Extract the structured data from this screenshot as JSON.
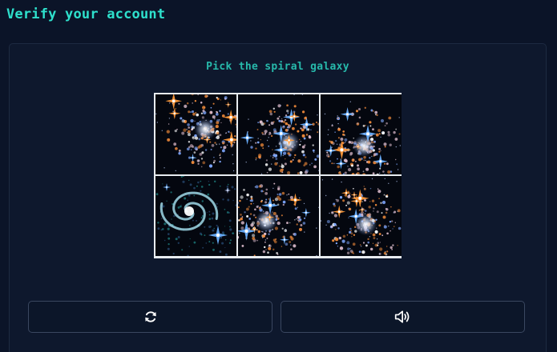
{
  "page": {
    "title": "Verify your account"
  },
  "captcha": {
    "prompt": "Pick the spiral galaxy",
    "tiles": [
      {
        "kind": "cluster",
        "seed": 11
      },
      {
        "kind": "cluster",
        "seed": 23
      },
      {
        "kind": "cluster",
        "seed": 37
      },
      {
        "kind": "spiral",
        "seed": 41
      },
      {
        "kind": "cluster",
        "seed": 53
      },
      {
        "kind": "cluster",
        "seed": 67
      }
    ],
    "refresh_icon": "refresh-icon",
    "audio_icon": "speaker-icon"
  },
  "colors": {
    "accent": "#2ee0cc",
    "background": "#0b1428",
    "panel": "#0e182d",
    "button_border": "#3a4760"
  }
}
